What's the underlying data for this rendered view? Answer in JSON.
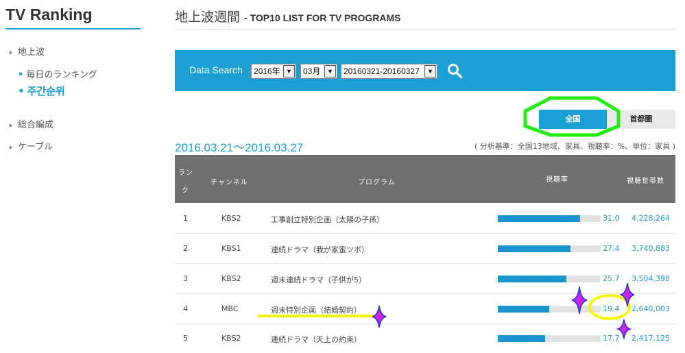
{
  "sidebar": {
    "title": "TV Ranking",
    "items": [
      {
        "label": "地上波"
      },
      {
        "label": "総合編成"
      },
      {
        "label": "ケーブル"
      }
    ],
    "subitems": [
      {
        "label": "毎日のランキング"
      },
      {
        "label": "주간순위"
      }
    ]
  },
  "header": {
    "title": "地上波週間",
    "subtitle": "- TOP10 LIST FOR TV PROGRAMS"
  },
  "search": {
    "label": "Data Search",
    "year": "2016年",
    "month": "03月",
    "week": "20160321-20160327"
  },
  "tabs": {
    "all": "全国",
    "metro": "首都圏"
  },
  "date_range": "2016.03.21～2016.03.27",
  "basis_note": "( 分析基準：全国13地域、家具、視聴率：%、単位：家具 )",
  "table": {
    "headers": {
      "rank_line1": "ラン",
      "rank_line2": "ク",
      "channel": "チャンネル",
      "program": "プログラム",
      "rating": "視聴率",
      "households": "視聴世帯数"
    },
    "rows": [
      {
        "rank": "1",
        "channel": "KBS2",
        "program": "工事創立特別企画（太陽の子孫）",
        "rating": "31.0",
        "households": "4,228,264"
      },
      {
        "rank": "2",
        "channel": "KBS1",
        "program": "連続ドラマ（我が家蜜ツボ）",
        "rating": "27.4",
        "households": "3,740,883"
      },
      {
        "rank": "3",
        "channel": "KBS2",
        "program": "週末連続ドラマ（子供が5）",
        "rating": "25.7",
        "households": "3,504,398"
      },
      {
        "rank": "4",
        "channel": "MBC",
        "program": "週末特別企画（結婚契約）",
        "rating": "19.4",
        "households": "2,640,003"
      },
      {
        "rank": "5",
        "channel": "KBS2",
        "program": "連続ドラマ（天上の約束）",
        "rating": "17.7",
        "households": "2,417,125"
      }
    ]
  },
  "bar_max": 38.7,
  "colors": {
    "accent": "#1aa0d4",
    "header_bg": "#6f6f70",
    "highlight_green": "#22ee11",
    "highlight_yellow": "#f5f500",
    "sparkle": "#cc22ee"
  }
}
